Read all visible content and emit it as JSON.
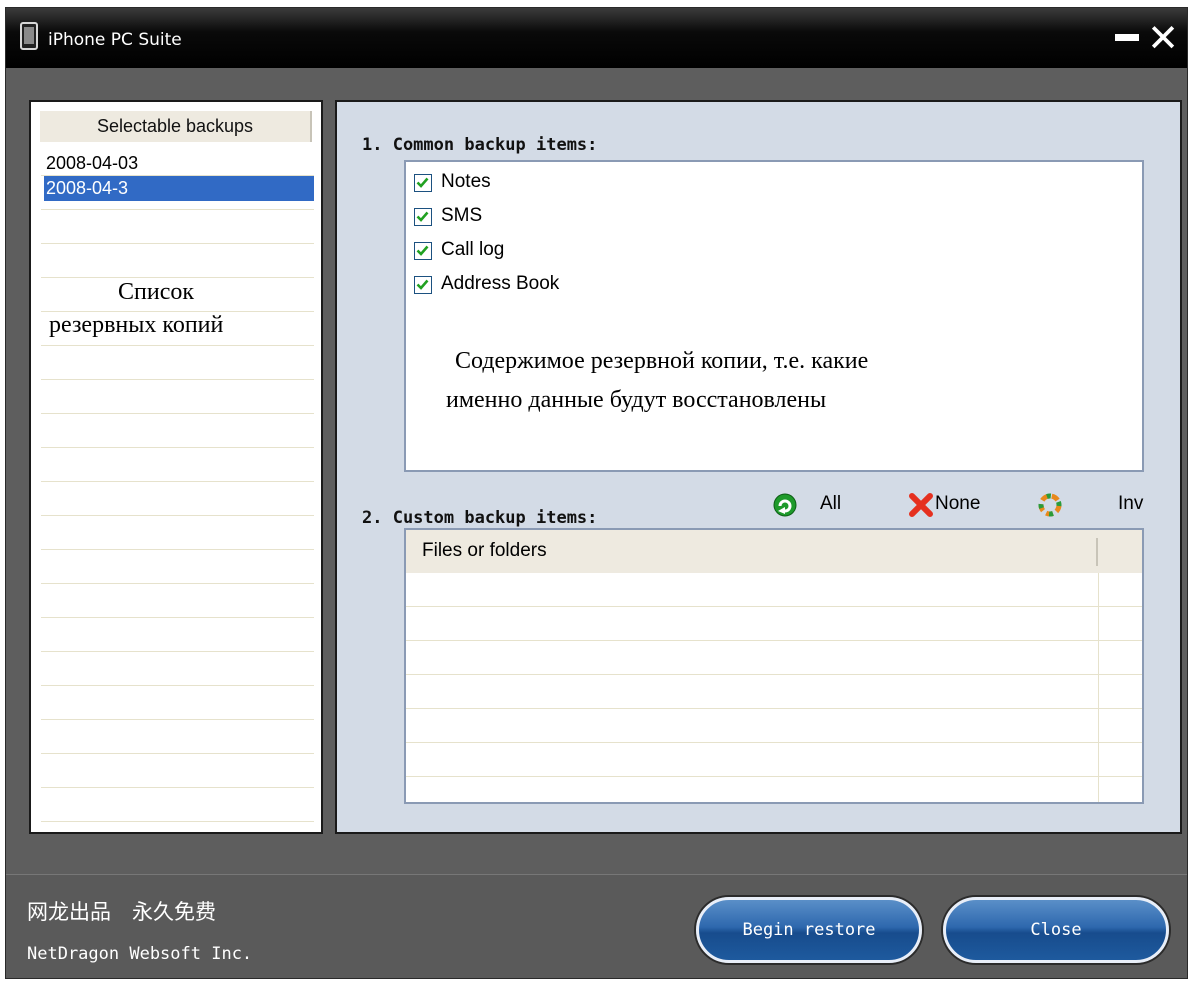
{
  "window": {
    "title": "iPhone PC Suite"
  },
  "left_panel": {
    "header": "Selectable backups",
    "items": [
      {
        "label": "2008-04-03",
        "selected": false
      },
      {
        "label": "2008-04-3",
        "selected": true
      }
    ],
    "annotation_line1": "Список",
    "annotation_line2": "резервных копий"
  },
  "common": {
    "title": "1. Common backup items:",
    "items": [
      {
        "label": "Notes",
        "checked": true
      },
      {
        "label": "SMS",
        "checked": true
      },
      {
        "label": "Call log",
        "checked": true
      },
      {
        "label": "Address Book",
        "checked": true
      }
    ],
    "annotation_line1": "Содержимое резервной копии, т.е. какие",
    "annotation_line2": "именно данные будут восстановлены"
  },
  "custom": {
    "title": "2. Custom backup items:",
    "toolbar": {
      "all": "All",
      "none": "None",
      "inv": "Inv"
    },
    "column_header": "Files or folders"
  },
  "footer": {
    "cn_text": "网龙出品　永久免费",
    "company": "NetDragon Websoft Inc.",
    "begin_restore": "Begin restore",
    "close": "Close"
  },
  "colors": {
    "selection": "#316ac5",
    "right_panel_bg": "#d3dbe6",
    "button_blue": "#2e68ae",
    "checkbox_border": "#1c5180",
    "check_mark": "#21a121"
  }
}
